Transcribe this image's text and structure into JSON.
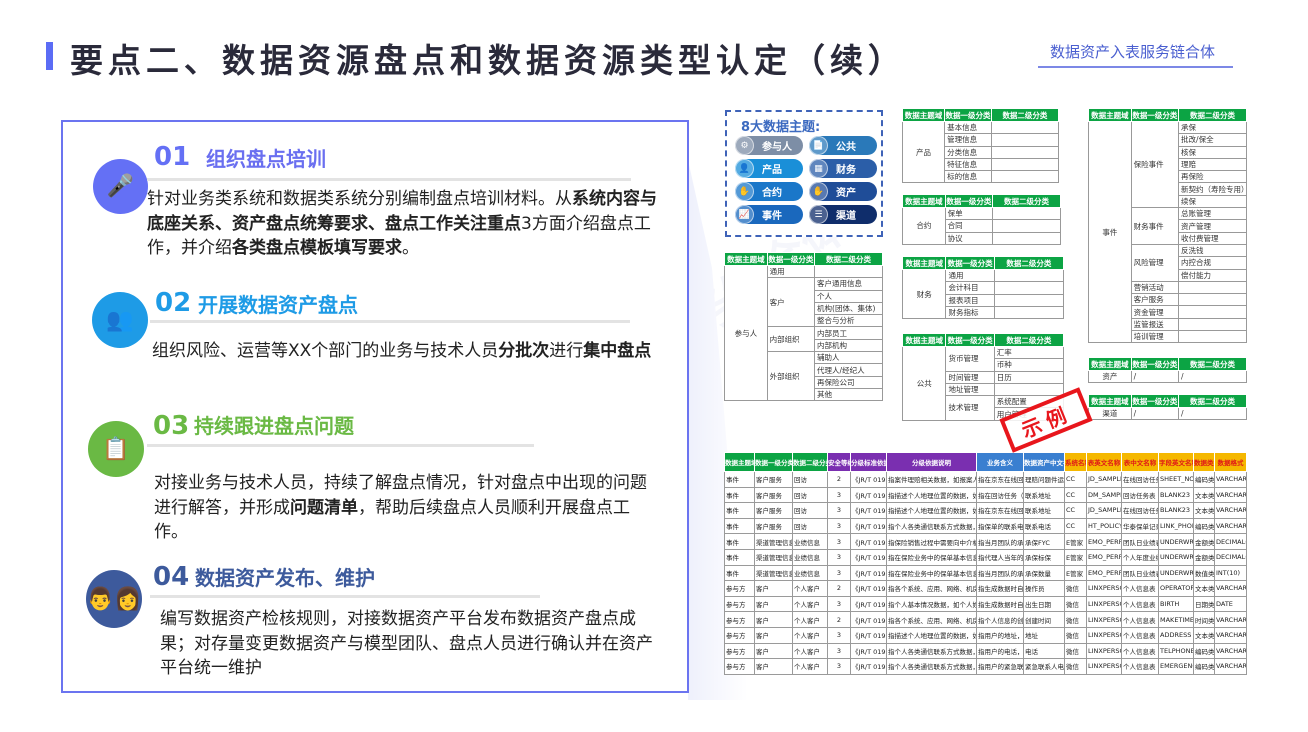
{
  "header": {
    "title": "要点二、数据资源盘点和数据资源类型认定（续）",
    "brand": "数据资产入表服务链合体",
    "accent_color": "#5b6cf5"
  },
  "watermark": "数据资产入表服务链合体",
  "sections": [
    {
      "num": "01",
      "title": "组织盘点培训",
      "color": "#6470f5",
      "icon": "podium-speaker-icon",
      "text_parts": [
        {
          "t": "针对业务类系统和数据类系统分别编制盘点培训材料。从",
          "b": false
        },
        {
          "t": "系统内容与底座关系、资产盘点统筹要求、盘点工作关注重点",
          "b": true
        },
        {
          "t": "3方面介绍盘点工作，并介绍",
          "b": false
        },
        {
          "t": "各类盘点模板填写要求",
          "b": true
        },
        {
          "t": "。",
          "b": false
        }
      ]
    },
    {
      "num": "02",
      "title": "开展数据资产盘点",
      "color": "#1e9be6",
      "icon": "people-working-icon",
      "text_parts": [
        {
          "t": "组织风险、运营等XX个部门的业务与技术人员",
          "b": false
        },
        {
          "t": "分批次",
          "b": true
        },
        {
          "t": "进行",
          "b": false
        },
        {
          "t": "集中盘点",
          "b": true
        }
      ]
    },
    {
      "num": "03",
      "title": "持续跟进盘点问题",
      "color": "#6ab944",
      "icon": "presenter-board-icon",
      "text_parts": [
        {
          "t": "对接业务与技术人员，持续了解盘点情况，针对盘点中出现的问题进行解答，并形成",
          "b": false
        },
        {
          "t": "问题清单",
          "b": true
        },
        {
          "t": "，帮助后续盘点人员顺利开展盘点工作。",
          "b": false
        }
      ]
    },
    {
      "num": "04",
      "title": "数据资产发布、维护",
      "color": "#3d5a9c",
      "icon": "meeting-table-icon",
      "text_parts": [
        {
          "t": "编写数据资产检核规则，对接数据资产平台发布数据资产盘点成果；对存量变更数据资产与模型团队、盘点人员进行确认并在资产平台统一维护",
          "b": false
        }
      ]
    }
  ],
  "themes": {
    "title": "8大数据主题:",
    "items": [
      {
        "label": "参与人",
        "icon": "gear-icon",
        "color": "#7d8ea6"
      },
      {
        "label": "产品",
        "icon": "user-icon",
        "color": "#1a8fd8"
      },
      {
        "label": "合约",
        "icon": "handshake-icon",
        "color": "#1a77c9"
      },
      {
        "label": "事件",
        "icon": "chart-icon",
        "color": "#1a68bd"
      },
      {
        "label": "公共",
        "icon": "document-icon",
        "color": "#2a79b9"
      },
      {
        "label": "财务",
        "icon": "calculator-icon",
        "color": "#2b5ea8"
      },
      {
        "label": "资产",
        "icon": "hand-coin-icon",
        "color": "#1f4d98"
      },
      {
        "label": "渠道",
        "icon": "network-icon",
        "color": "#0f2d6b"
      }
    ]
  },
  "small_table_headers": [
    "数据主题域",
    "数据一级分类",
    "数据二级分类"
  ],
  "small_tables": [
    {
      "domain": "产品",
      "rows": [
        {
          "l1": "基本信息",
          "l2": [
            ""
          ]
        },
        {
          "l1": "管理信息",
          "l2": [
            ""
          ]
        },
        {
          "l1": "分类信息",
          "l2": [
            ""
          ]
        },
        {
          "l1": "特征信息",
          "l2": [
            ""
          ]
        },
        {
          "l1": "标的信息",
          "l2": [
            ""
          ]
        }
      ]
    },
    {
      "domain": "合约",
      "rows": [
        {
          "l1": "保单",
          "l2": [
            ""
          ]
        },
        {
          "l1": "合同",
          "l2": [
            ""
          ]
        },
        {
          "l1": "协议",
          "l2": [
            ""
          ]
        }
      ]
    },
    {
      "domain": "参与人",
      "rows": [
        {
          "l1": "通用",
          "l2": [
            ""
          ]
        },
        {
          "l1": "客户",
          "l2": [
            "客户通用信息",
            "个人",
            "机构(团体、集体)",
            "整合与分析"
          ]
        },
        {
          "l1": "内部组织",
          "l2": [
            "内部员工",
            "内部机构"
          ]
        },
        {
          "l1": "外部组织",
          "l2": [
            "辅助人",
            "代理人/经纪人",
            "再保险公司",
            "其他"
          ]
        }
      ]
    },
    {
      "domain": "财务",
      "rows": [
        {
          "l1": "通用",
          "l2": [
            ""
          ]
        },
        {
          "l1": "会计科目",
          "l2": [
            ""
          ]
        },
        {
          "l1": "报表项目",
          "l2": [
            ""
          ]
        },
        {
          "l1": "财务指标",
          "l2": [
            ""
          ]
        }
      ]
    },
    {
      "domain": "公共",
      "rows": [
        {
          "l1": "货币管理",
          "l2": [
            "汇率",
            "币种"
          ]
        },
        {
          "l1": "时间管理",
          "l2": [
            "日历"
          ]
        },
        {
          "l1": "地址管理",
          "l2": [
            ""
          ]
        },
        {
          "l1": "技术管理",
          "l2": [
            "系统配置",
            "用户管理"
          ]
        }
      ]
    },
    {
      "domain": "事件",
      "rows": [
        {
          "l1": "保险事件",
          "l2": [
            "承保",
            "批改/保全",
            "核保",
            "理赔",
            "再保险",
            "新契约（寿险专用）",
            "续保"
          ]
        },
        {
          "l1": "财务事件",
          "l2": [
            "总账管理",
            "资产管理",
            "收付费管理"
          ]
        },
        {
          "l1": "风险管理",
          "l2": [
            "反洗钱",
            "内控合规",
            "偿付能力"
          ]
        },
        {
          "l1": "营销活动",
          "l2": [
            ""
          ]
        },
        {
          "l1": "客户服务",
          "l2": [
            ""
          ]
        },
        {
          "l1": "资金管理",
          "l2": [
            ""
          ]
        },
        {
          "l1": "监管报送",
          "l2": [
            ""
          ]
        },
        {
          "l1": "培训管理",
          "l2": [
            ""
          ]
        }
      ]
    },
    {
      "domain": "资产",
      "rows": [
        {
          "l1": "/",
          "l2": [
            "/"
          ]
        }
      ]
    },
    {
      "domain": "渠道",
      "rows": [
        {
          "l1": "/",
          "l2": [
            "/"
          ]
        }
      ]
    }
  ],
  "stamp": "示例",
  "big_table": {
    "headers": [
      "数据主题域",
      "数据一级分类",
      "数据二级分类",
      "安全等级",
      "分级标准依据",
      "分级依据说明",
      "业务含义",
      "数据资产中文名",
      "系统名称",
      "表英文名称",
      "表中文名称",
      "字段英文名称",
      "数据类型",
      "数据格式"
    ],
    "header_colors": [
      "#0ca444",
      "#0ca444",
      "#0ca444",
      "#7a2fb0",
      "#7a2fb0",
      "#7a2fb0",
      "#3a7fd0",
      "#3a7fd0",
      "#f5b800",
      "#f5b800",
      "#f5b800",
      "#f5b800",
      "#f5b800",
      "#f5b800"
    ],
    "rows": [
      [
        "事件",
        "客户服务",
        "回访",
        "2",
        "《JR/T 0197-202",
        "指案件理赔相关数据，如报案人、出险人、",
        "指在京东在线回访任",
        "理赔问题件运保单",
        "CC",
        "JD_SAMPLE",
        "在线回访任务表",
        "SHEET_NO_LP",
        "编码类",
        "VARCHAR2(1"
      ],
      [
        "事件",
        "客户服务",
        "回访",
        "3",
        "《JR/T 0197-202",
        "指描述个人地理位置的数据，如所在国家、",
        "指在回访任务（联系",
        "联系地址",
        "CC",
        "DM_SAMPLE",
        "回访任务表",
        "BLANK23",
        "文本类",
        "VARCHAR2(7"
      ],
      [
        "事件",
        "客户服务",
        "回访",
        "3",
        "《JR/T 0197-202",
        "指描述个人地理位置的数据，如所在国家、",
        "指在京东在线回访任",
        "联系地址",
        "CC",
        "JD_SAMPLE",
        "在线回访任务表",
        "BLANK23",
        "文本类",
        "VARCHAR2(7"
      ],
      [
        "事件",
        "客户服务",
        "回访",
        "3",
        "《JR/T 0197-202",
        "指个人各类通信联系方式数据，如手机、固",
        "指保单的联系电话，",
        "联系电话",
        "CC",
        "HT_POLICY",
        "华泰保单记录表",
        "LINK_PHONE",
        "编码类",
        "VARCHAR2(3"
      ],
      [
        "事件",
        "渠道管理信息",
        "业绩信息",
        "3",
        "《JR/T 0197-202",
        "指保险销售过程中需要向中介机构、代理人",
        "指当月团队的承保FY",
        "承保FYC",
        "E管家",
        "EMO_PERFORM",
        "团队日业绩表",
        "UNDERWRITE_",
        "金额类",
        "DECIMAL(16,"
      ],
      [
        "事件",
        "渠道管理信息",
        "业绩信息",
        "3",
        "《JR/T 0197-202",
        "指在保险业务中的保单基本信息数据，如",
        "指代理人当年的承保",
        "承保标保",
        "E管家",
        "EMO_PERFORM",
        "个人年度业绩表",
        "UNDERWRITE_",
        "金额类",
        "DECIMAL(14,"
      ],
      [
        "事件",
        "渠道管理信息",
        "业绩信息",
        "3",
        "《JR/T 0197-202",
        "指在保险业务中的保单基本信息数据，如",
        "指当月团队的承保件",
        "承保数量",
        "E管家",
        "EMO_PERFORM",
        "团队日业绩表",
        "UNDERWRITE_",
        "数值类",
        "INT(10)"
      ],
      [
        "参与方",
        "客户",
        "个人客户",
        "2",
        "《JR/T 0197-202",
        "指各个系统、应用、网络、机房设施、监控",
        "指生成数据时自动生",
        "操作员",
        "微信",
        "LINXPERSONA",
        "个人信息表",
        "OPERATOR",
        "文本类",
        "VARCHAR2(2"
      ],
      [
        "参与方",
        "客户",
        "个人客户",
        "3",
        "《JR/T 0197-202",
        "指个人基本情况数据，如个人姓名、性别、",
        "指生成数据时自动生",
        "出生日期",
        "微信",
        "LINXPERSONA",
        "个人信息表",
        "BIRTH",
        "日期类",
        "DATE"
      ],
      [
        "参与方",
        "客户",
        "个人客户",
        "2",
        "《JR/T 0197-202",
        "指各个系统、应用、网络、机房设施、监控",
        "指个人信息的创建时",
        "创建时间",
        "微信",
        "LINXPERSONA",
        "个人信息表",
        "MAKETIME",
        "时间类",
        "VARCHAR2(6"
      ],
      [
        "参与方",
        "客户",
        "个人客户",
        "3",
        "《JR/T 0197-203",
        "指描述个人地理位置的数据，如所在国家、",
        "指用户的地址，",
        "地址",
        "微信",
        "LINXPERSONA",
        "个人信息表",
        "ADDRESS",
        "文本类",
        "VARCHAR2(1"
      ],
      [
        "参与方",
        "客户",
        "个人客户",
        "3",
        "《JR/T 0197-203",
        "指个人各类通信联系方式数据，如手机、固",
        "指用户的电话，",
        "电话",
        "微信",
        "LINXPERSONA",
        "个人信息表",
        "TELPHONE",
        "编码类",
        "VARCHAR2(3"
      ],
      [
        "参与方",
        "客户",
        "个人客户",
        "3",
        "《JR/T 0197-203",
        "指个人各类通信联系方式数据，如手机、固",
        "指用户的紧急联系人",
        "紧急联系人电话",
        "微信",
        "LINXPERSONA",
        "个人信息表",
        "EMERGENCYTE",
        "编码类",
        "VARCHAR2(1"
      ]
    ]
  }
}
